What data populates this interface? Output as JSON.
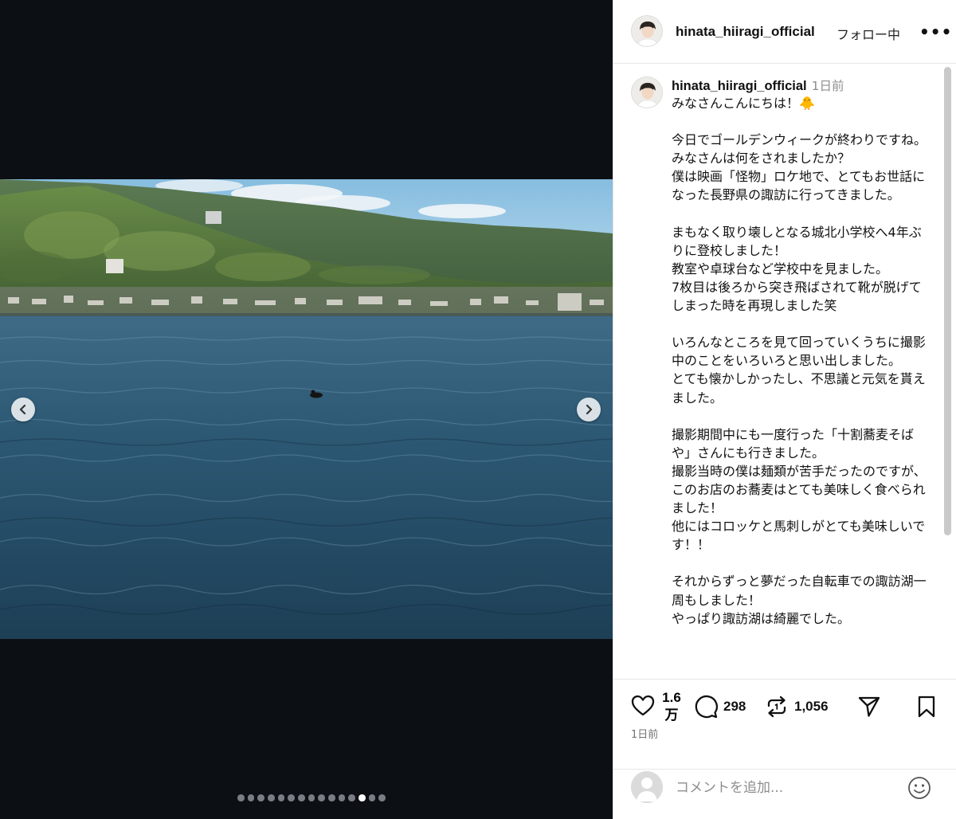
{
  "post": {
    "username": "hinata_hiiragi_official",
    "follow_status": "フォロー中",
    "more": "•••",
    "time_relative": "1日前",
    "caption": "みなさんこんにちは！🐥\n\n今日でゴールデンウィークが終わりですね。\nみなさんは何をされましたか？\n僕は映画「怪物」ロケ地で、とてもお世話になった長野県の諏訪に行ってきました。\n\nまもなく取り壊しとなる城北小学校へ4年ぶりに登校しました！\n教室や卓球台など学校中を見ました。\n7枚目は後ろから突き飛ばされて靴が脱げてしまった時を再現しました笑\n\nいろんなところを見て回っていくうちに撮影中のことをいろいろと思い出しました。\nとても懐かしかったし、不思議と元気を貰えました。\n\n撮影期間中にも一度行った「十割蕎麦そばや」さんにも行きました。\n撮影当時の僕は麺類が苦手だったのですが、このお店のお蕎麦はとても美味しく食べられました！\n他にはコロッケと馬刺しがとても美味しいです！！\n\nそれからずっと夢だった自転車での諏訪湖一周もしました！\nやっぱり諏訪湖は綺麗でした。"
  },
  "stats": {
    "likes_line1": "1.6",
    "likes_line2": "万",
    "comments": "298",
    "reposts": "1,056",
    "posted": "1日前"
  },
  "comment": {
    "placeholder": "コメントを追加..."
  },
  "carousel": {
    "total": 15,
    "current": 13
  },
  "icons": {
    "prev": "chevron-left-icon",
    "next": "chevron-right-icon",
    "like": "heart-icon",
    "comment": "comment-bubble-icon",
    "repost": "repost-icon",
    "share": "send-icon",
    "save": "bookmark-icon",
    "emoji": "smiley-icon"
  }
}
